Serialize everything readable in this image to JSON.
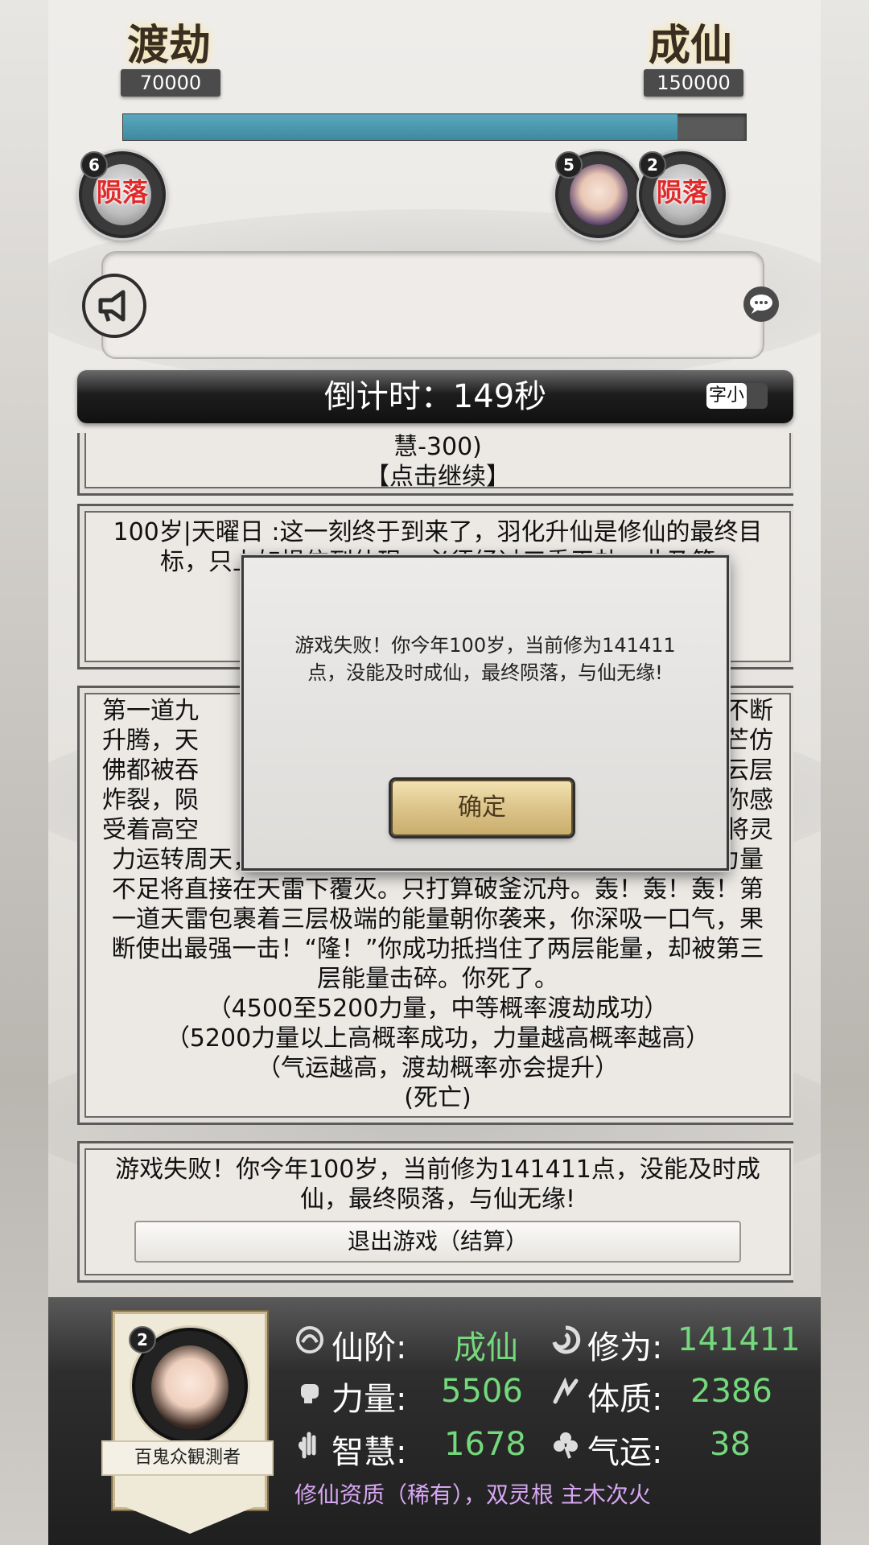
{
  "header": {
    "left_milestone": {
      "title": "渡劫",
      "value": "70000"
    },
    "right_milestone": {
      "title": "成仙",
      "value": "150000"
    },
    "progress_fraction": 0.89
  },
  "players": [
    {
      "count": "6",
      "status": "陨落"
    },
    {
      "count": "5",
      "status": ""
    },
    {
      "count": "2",
      "status": "陨落"
    }
  ],
  "countdown": {
    "text": "倒计时：149秒",
    "font_toggle": "字小"
  },
  "log": {
    "card1": {
      "partial": "慧-300)",
      "continue": "【点击继续】"
    },
    "card2": {
      "text": "100岁|天曜日 :这一刻终于到来了，羽化升仙是修仙的最终目标，只上如损信到仙现，必须经过三重天劫，此乃第"
    },
    "card3": {
      "line1": "第一道九",
      "line1_right": "开始不断",
      "line2": "升腾，天",
      "line2_right": "的光芒仿",
      "line3": "佛都被吞",
      "line3_right": "雷在云层",
      "line4": "炸裂，陨",
      "line4_right": "击！你感",
      "line5": "受着高空",
      "line5_right": "，你将灵",
      "rest": "力运转周天，用你最强的招式准备迎击天劫。你清楚知道力量不足将直接在天雷下覆灭。只打算破釜沉舟。轰！轰！轰！第一道天雷包裹着三层极端的能量朝你袭来，你深吸一口气，果断使出最强一击！“隆！”你成功抵挡住了两层能量，却被第三层能量击碎。你死了。",
      "note1": "（4500至5200力量，中等概率渡劫成功）",
      "note2": "（5200力量以上高概率成功，力量越高概率越高）",
      "note3": "（气运越高，渡劫概率亦会提升）",
      "note4": "(死亡)"
    },
    "card4": {
      "text": "游戏失败！你今年100岁，当前修为141411点，没能及时成仙，最终陨落，与仙无缘!",
      "exit_label": "退出游戏（结算）"
    }
  },
  "modal": {
    "message": "游戏失败！你今年100岁，当前修为141411点，没能及时成仙，最终陨落，与仙无缘!",
    "confirm_label": "确定"
  },
  "player": {
    "badge": "2",
    "name": "百鬼众観測者",
    "stats": {
      "realm_label": "仙阶:",
      "realm_value": "成仙",
      "cultivation_label": "修为:",
      "cultivation_value": "141411",
      "strength_label": "力量:",
      "strength_value": "5506",
      "constitution_label": "体质:",
      "constitution_value": "2386",
      "wisdom_label": "智慧:",
      "wisdom_value": "1678",
      "luck_label": "气运:",
      "luck_value": "38"
    },
    "aptitude": "修仙资质（稀有），双灵根 主木次火"
  },
  "colors": {
    "stat_value": "#74d97c",
    "fallen": "#e02a2a",
    "progress": "#3d8aa0",
    "aptitude": "#d6a6f2"
  }
}
